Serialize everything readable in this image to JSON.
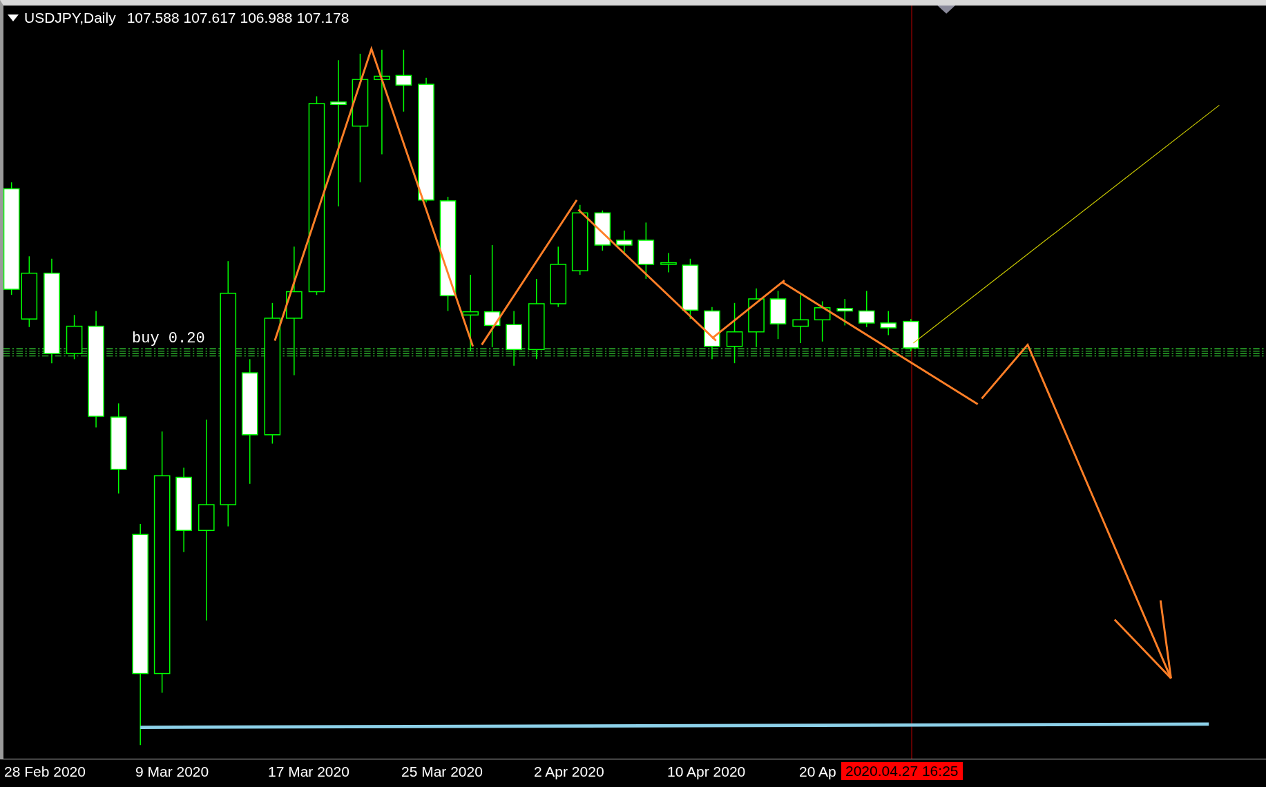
{
  "header": {
    "symbol": "USDJPY,Daily",
    "prices": [
      "107.588",
      "107.617",
      "106.988",
      "107.178"
    ]
  },
  "order_label": "buy 0.20",
  "x_axis": {
    "labels": [
      "28 Feb 2020",
      "9 Mar 2020",
      "17 Mar 2020",
      "25 Mar 2020",
      "2 Apr 2020",
      "10 Apr 2020",
      "20 Ap"
    ],
    "cursor_time": "2020.04.27 16:25"
  }
}
